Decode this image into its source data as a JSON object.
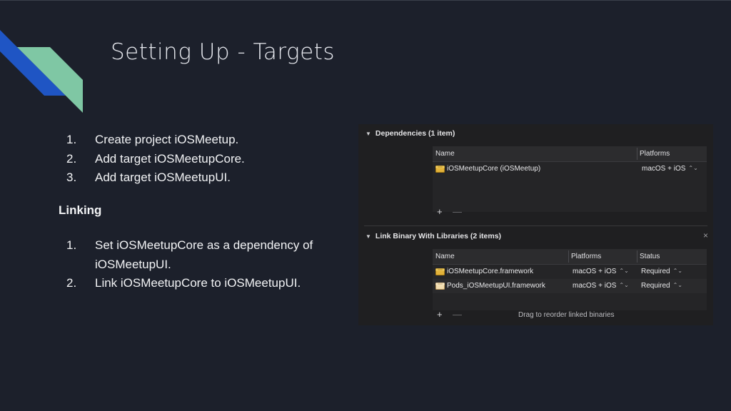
{
  "slide": {
    "title": "Setting Up - Targets",
    "steps_1": [
      {
        "num": "1.",
        "text": "Create project iOSMeetup."
      },
      {
        "num": "2.",
        "text": "Add target iOSMeetupCore."
      },
      {
        "num": "3.",
        "text": "Add target iOSMeetupUI."
      }
    ],
    "linking_heading": "Linking",
    "steps_2": [
      {
        "num": "1.",
        "text": "Set  iOSMeetupCore as a dependency of iOSMeetupUI."
      },
      {
        "num": "2.",
        "text": "Link iOSMeetupCore to iOSMeetupUI."
      }
    ],
    "colors": {
      "background": "#1c202b",
      "deco_blue": "#1f55c4",
      "deco_green": "#7fc7a4"
    }
  },
  "xcode": {
    "dependencies": {
      "title": "Dependencies (1 item)",
      "headers": {
        "name": "Name",
        "platforms": "Platforms"
      },
      "rows": [
        {
          "icon": "framework-icon",
          "name": "iOSMeetupCore (iOSMeetup)",
          "platforms": "macOS + iOS"
        }
      ],
      "add": "+",
      "remove": "—"
    },
    "link_binary": {
      "title": "Link Binary With Libraries (2 items)",
      "close": "×",
      "headers": {
        "name": "Name",
        "platforms": "Platforms",
        "status": "Status"
      },
      "rows": [
        {
          "icon": "framework-icon",
          "name": "iOSMeetupCore.framework",
          "platforms": "macOS + iOS",
          "status": "Required"
        },
        {
          "icon": "framework-icon",
          "name": "Pods_iOSMeetupUI.framework",
          "platforms": "macOS + iOS",
          "status": "Required"
        }
      ],
      "add": "+",
      "remove": "—",
      "hint": "Drag to reorder linked binaries"
    }
  }
}
